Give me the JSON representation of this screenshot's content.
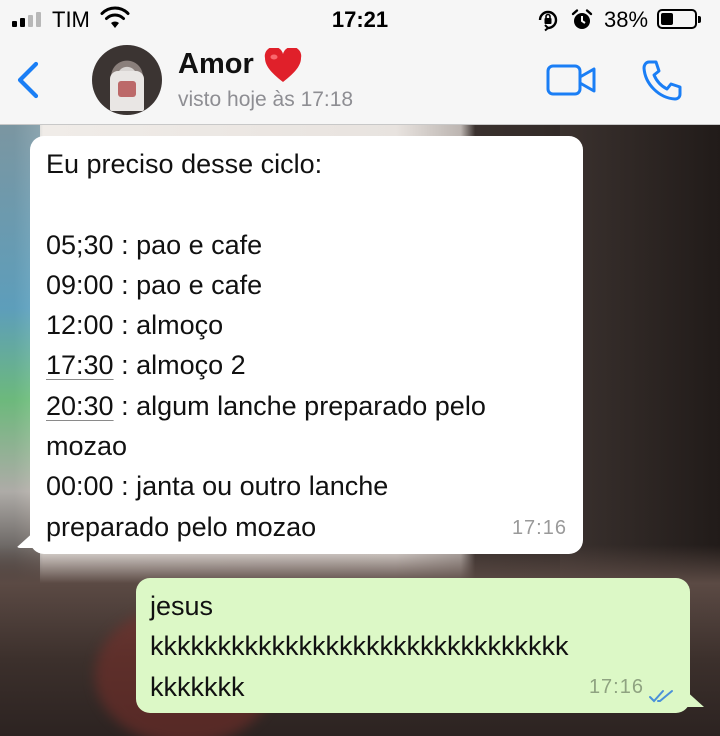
{
  "status_bar": {
    "carrier": "TIM",
    "time": "17:21",
    "battery_percent": "38%",
    "battery_level": 0.38,
    "signal_bars_filled": 2,
    "icons": [
      "signal-icon",
      "wifi-icon",
      "rotation-lock-icon",
      "alarm-icon",
      "battery-icon"
    ]
  },
  "header": {
    "back_icon": "chevron-left-icon",
    "contact_name": "Amor",
    "name_emoji": "❤️",
    "last_seen": "visto hoje às 17:18",
    "actions": [
      "video-call-icon",
      "phone-icon"
    ],
    "accent_color": "#1a7ef5"
  },
  "messages": [
    {
      "direction": "incoming",
      "lines": [
        "Eu preciso desse ciclo:",
        "",
        "05;30 : pao e cafe",
        "09:00 : pao e cafe",
        "12:00 : almoço"
      ],
      "linked_rows": [
        {
          "time": "17:30",
          "rest": " : almoço 2"
        },
        {
          "time": "20:30",
          "rest": " : algum lanche preparado pelo"
        }
      ],
      "tail_lines": [
        "mozao",
        "00:00 : janta ou outro lanche",
        "preparado pelo mozao"
      ],
      "time": "17:16"
    },
    {
      "direction": "outgoing",
      "lines": [
        "jesus",
        "kkkkkkkkkkkkkkkkkkkkkkkkkkkkkkk",
        "kkkkkkk"
      ],
      "time": "17:16",
      "status_icon": "double-check-icon",
      "bubble_color": "#dcf8c6"
    }
  ]
}
